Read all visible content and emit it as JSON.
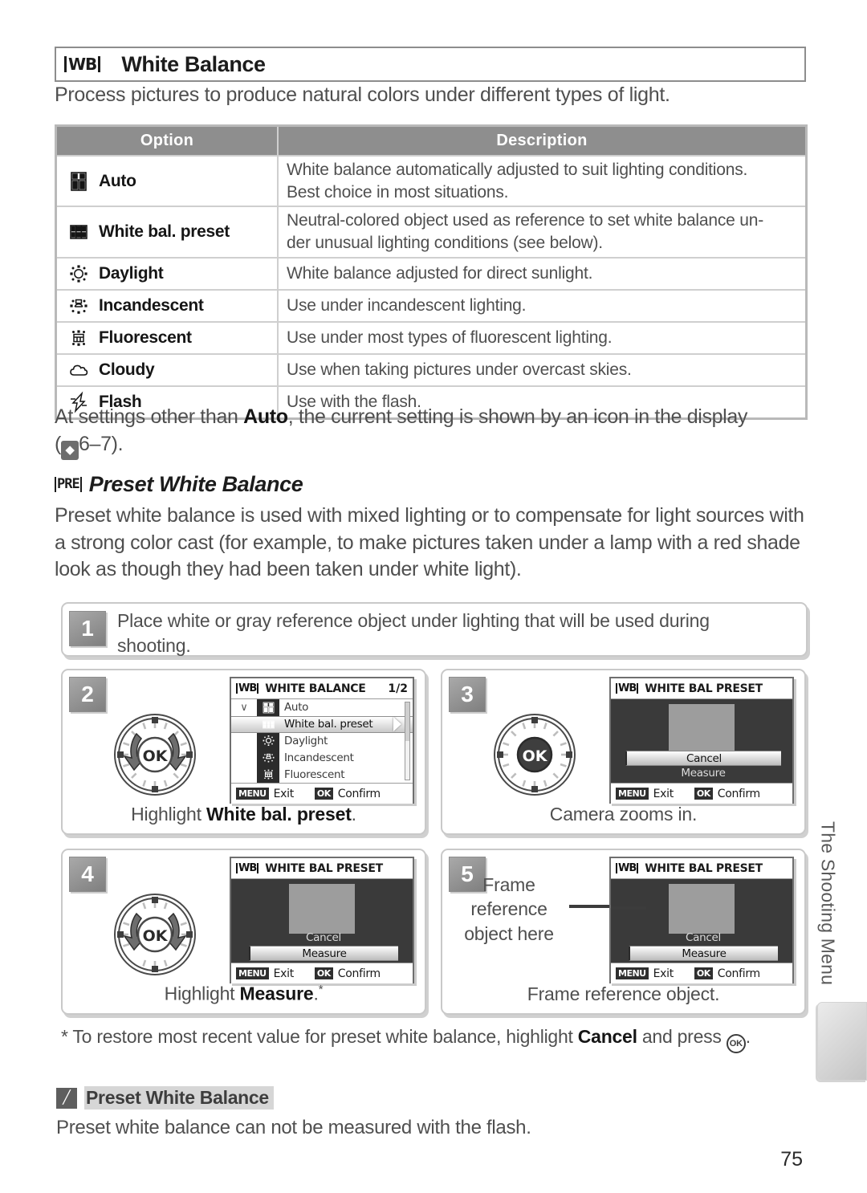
{
  "section": {
    "icon": "white-balance-icon",
    "icon_glyph": "WB",
    "title": "White Balance",
    "intro": "Process pictures to produce natural colors under different types of light."
  },
  "options_table": {
    "headers": [
      "Option",
      "Description"
    ],
    "rows": [
      {
        "icon": "auto-wb-icon",
        "label": "Auto",
        "description_lines": [
          "White balance automatically adjusted to suit lighting conditions.",
          "Best choice in most situations."
        ]
      },
      {
        "icon": "preset-wb-icon",
        "label": "White bal. preset",
        "description_lines": [
          "Neutral-colored object used as reference to set white balance un-",
          "der unusual lighting conditions (see below)."
        ]
      },
      {
        "icon": "daylight-icon",
        "label": "Daylight",
        "description_lines": [
          "White balance adjusted for direct sunlight."
        ]
      },
      {
        "icon": "incandescent-icon",
        "label": "Incandescent",
        "description_lines": [
          "Use under incandescent lighting."
        ]
      },
      {
        "icon": "fluorescent-icon",
        "label": "Fluorescent",
        "description_lines": [
          "Use under most types of fluorescent lighting."
        ]
      },
      {
        "icon": "cloudy-icon",
        "label": "Cloudy",
        "description_lines": [
          "Use when taking pictures under overcast skies."
        ]
      },
      {
        "icon": "flash-icon",
        "label": "Flash",
        "description_lines": [
          "Use with the flash."
        ]
      }
    ]
  },
  "note_after_table": {
    "part1": "At settings other than ",
    "bold": "Auto",
    "part2": ", the current setting is shown by an icon in the display",
    "ref_icon": "book-reference-icon",
    "ref": "6–7)."
  },
  "preset_section": {
    "icon": "preset-wb-icon",
    "icon_glyph": "PRE",
    "heading": "Preset White Balance",
    "body": "Preset white balance is used with mixed lighting or to compensate for light sources with a strong color cast (for example, to make pictures taken under a lamp with a red shade look as though they had been taken under white light)."
  },
  "steps": [
    {
      "number": "1",
      "text_line1": "Place white or gray reference object under lighting that will be used during",
      "text_line2": "shooting."
    },
    {
      "number": "2",
      "caption_prefix": "Highlight ",
      "caption_bold": "White bal. preset",
      "caption_suffix": ".",
      "dial": "multi-selector-dial-updown",
      "screen": {
        "wb_glyph": "WB",
        "title": "WHITE BALANCE",
        "page": "1/2",
        "menu_items": [
          {
            "icon": "auto-wb-icon",
            "label": "Auto",
            "checked": true,
            "selected": false
          },
          {
            "icon": "preset-wb-icon",
            "label": "White bal. preset",
            "checked": false,
            "selected": true
          },
          {
            "icon": "daylight-icon",
            "label": "Daylight",
            "checked": false,
            "selected": false
          },
          {
            "icon": "incandescent-icon",
            "label": "Incandescent",
            "checked": false,
            "selected": false
          },
          {
            "icon": "fluorescent-icon",
            "label": "Fluorescent",
            "checked": false,
            "selected": false
          }
        ],
        "menu_button": "MENU",
        "menu_action": "Exit",
        "ok_button": "OK",
        "ok_action": "Confirm"
      }
    },
    {
      "number": "3",
      "caption_prefix": "Camera zooms in.",
      "dial": "multi-selector-dial-ok",
      "screen": {
        "wb_glyph": "WB",
        "title": "WHITE BAL PRESET",
        "cancel_label": "Cancel",
        "measure_label": "Measure",
        "highlighted": "Cancel",
        "menu_button": "MENU",
        "menu_action": "Exit",
        "ok_button": "OK",
        "ok_action": "Confirm"
      }
    },
    {
      "number": "4",
      "caption_prefix": "Highlight ",
      "caption_bold": "Measure",
      "caption_suffix": ".",
      "caption_footnote_marker": "*",
      "dial": "multi-selector-dial-updown",
      "screen": {
        "wb_glyph": "WB",
        "title": "WHITE BAL PRESET",
        "cancel_label": "Cancel",
        "measure_label": "Measure",
        "highlighted": "Measure",
        "menu_button": "MENU",
        "menu_action": "Exit",
        "ok_button": "OK",
        "ok_action": "Confirm"
      }
    },
    {
      "number": "5",
      "caption_prefix": "Frame reference object.",
      "annotation": "Frame reference object here",
      "screen": {
        "wb_glyph": "WB",
        "title": "WHITE BAL PRESET",
        "cancel_label": "Cancel",
        "measure_label": "Measure",
        "highlighted": "Measure",
        "menu_button": "MENU",
        "menu_action": "Exit",
        "ok_button": "OK",
        "ok_action": "Confirm"
      }
    }
  ],
  "footnote": {
    "part1": "* To restore most recent value for preset white balance, highlight ",
    "bold": "Cancel",
    "part2": " and press ",
    "ok_icon": "ok-button-icon",
    "ok_glyph": "OK",
    "end": "."
  },
  "tip": {
    "icon": "pencil-note-icon",
    "title": "Preset White Balance",
    "body": "Preset white balance can not be measured with the flash."
  },
  "side_tab": {
    "label": "The Shooting Menu"
  },
  "page_number": "75"
}
